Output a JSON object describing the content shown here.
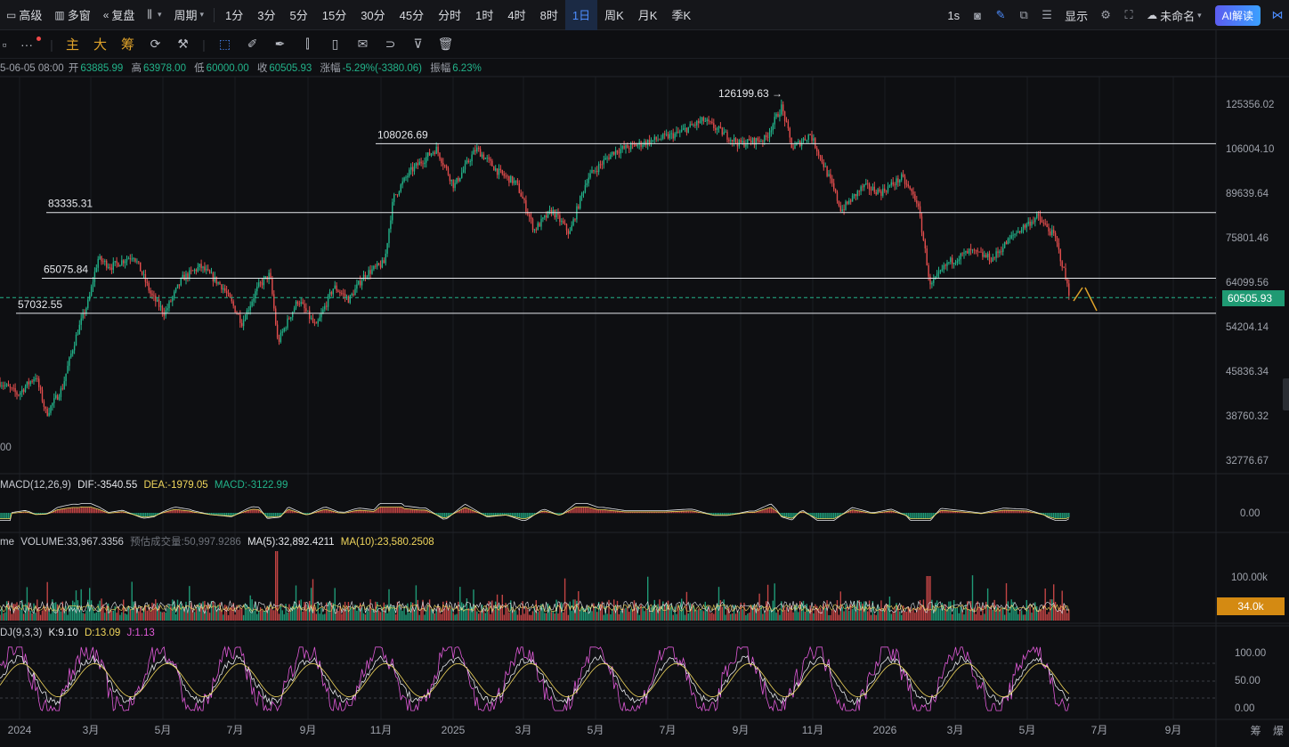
{
  "toolbar": {
    "left_items": [
      {
        "icon": "calendar-icon",
        "glyph": "▭",
        "label": "高级"
      },
      {
        "icon": "multi-window-icon",
        "glyph": "▥",
        "label": "多窗"
      },
      {
        "icon": "replay-icon",
        "glyph": "«",
        "label": "复盘"
      },
      {
        "icon": "chart-type-icon",
        "glyph": "⫼",
        "label": ""
      },
      {
        "icon": "",
        "glyph": "",
        "label": "周期"
      }
    ],
    "periods": [
      "1分",
      "3分",
      "5分",
      "15分",
      "30分",
      "45分",
      "分时",
      "1时",
      "4时",
      "8时",
      "1日",
      "周K",
      "月K",
      "季K"
    ],
    "active_period": "1日",
    "interval": "1s",
    "display_label": "显示",
    "layout_label": "未命名",
    "ai_label": "AI解读"
  },
  "drawbar": {
    "dots": "···",
    "main": "主",
    "big": "大",
    "chips": "筹"
  },
  "info": {
    "datetime": "5-06-05 08:00",
    "open_label": "开",
    "open": "63885.99",
    "high_label": "高",
    "high": "63978.00",
    "low_label": "低",
    "low": "60000.00",
    "close_label": "收",
    "close": "60505.93",
    "change_label": "涨幅",
    "change": "-5.29%(-3380.06)",
    "amp_label": "振幅",
    "amp": "6.23%"
  },
  "price_axis": [
    "125356.02",
    "106004.10",
    "89639.64",
    "75801.46",
    "64099.56",
    "54204.14",
    "45836.34",
    "38760.32",
    "32776.67"
  ],
  "current_price": "60505.93",
  "levels": [
    {
      "label": "126199.63 →",
      "value": 126199.63
    },
    {
      "label": "108026.69",
      "value": 108026.69
    },
    {
      "label": "83335.31",
      "value": 83335.31
    },
    {
      "label": "65075.84",
      "value": 65075.84
    },
    {
      "label": "57032.55",
      "value": 57032.55
    }
  ],
  "left_cut_label": "00",
  "macd": {
    "name": "MACD(12,26,9)",
    "dif_label": "DIF:",
    "dif": "-3540.55",
    "dea_label": "DEA:",
    "dea": "-1979.05",
    "macd_label": "MACD:",
    "macd": "-3122.99",
    "axis": [
      "0.00"
    ]
  },
  "volume": {
    "name": "me",
    "vol_label": "VOLUME:",
    "vol": "33,967.3356",
    "est_label": "预估成交量:",
    "est": "50,997.9286",
    "ma5_label": "MA(5):",
    "ma5": "32,892.4211",
    "ma10_label": "MA(10):",
    "ma10": "23,580.2508",
    "axis": [
      "100.00k"
    ],
    "badge": "34.0k"
  },
  "kdj": {
    "name": "DJ(9,3,3)",
    "k_label": "K:",
    "k": "9.10",
    "d_label": "D:",
    "d": "13.09",
    "j_label": "J:",
    "j": "1.13",
    "axis": [
      "100.00",
      "50.00",
      "0.00"
    ]
  },
  "dates": [
    "2024",
    "3月",
    "5月",
    "7月",
    "9月",
    "11月",
    "2025",
    "3月",
    "5月",
    "7月",
    "9月",
    "11月",
    "2026",
    "3月",
    "5月",
    "7月",
    "9月"
  ],
  "bottom_right": [
    "筹",
    "爆"
  ],
  "colors": {
    "up": "#22b38a",
    "down": "#e24d4d",
    "accent": "#4d8dff",
    "yellow": "#f0d65c",
    "pink": "#e05ad8"
  }
}
